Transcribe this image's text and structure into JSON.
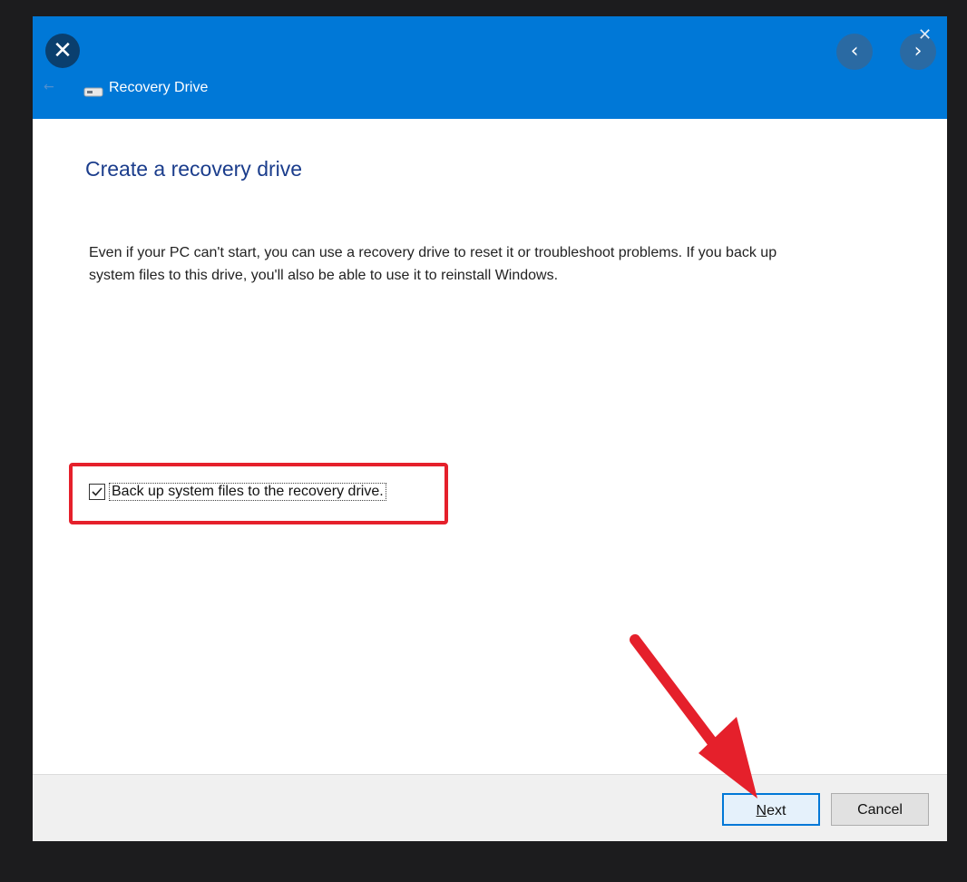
{
  "window": {
    "title": "Recovery Drive",
    "close_glyph": "✕",
    "corner_close_glyph": "✕",
    "back_glyph": "←",
    "nav_prev_glyph": "‹",
    "nav_next_glyph": "›"
  },
  "content": {
    "heading": "Create a recovery drive",
    "description": "Even if your PC can't start, you can use a recovery drive to reset it or troubleshoot problems. If you back up system files to this drive, you'll also be able to use it to reinstall Windows.",
    "checkbox": {
      "label": "Back up system files to the recovery drive.",
      "checked": true
    }
  },
  "footer": {
    "next_label": "Next",
    "cancel_label": "Cancel"
  },
  "annotations": {
    "highlight_color": "#e5202b",
    "arrow_color": "#e5202b"
  },
  "icons": [
    "close-icon",
    "drive-icon",
    "back-arrow-icon",
    "chevron-left-icon",
    "chevron-right-icon",
    "checkmark-icon"
  ]
}
